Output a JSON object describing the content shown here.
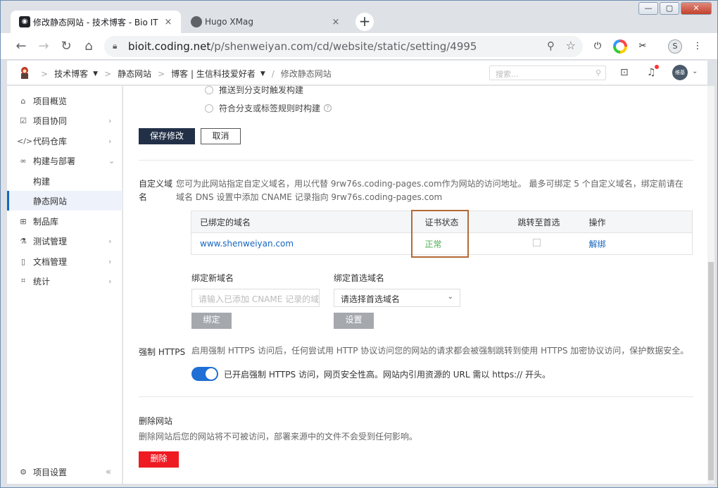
{
  "browser": {
    "tabs": [
      {
        "title": "修改静态网站 - 技术博客 - Bio IT",
        "close": "×"
      },
      {
        "title": "Hugo XMag",
        "close": "×"
      }
    ],
    "new_tab": "+",
    "window_buttons": {
      "min": "—",
      "max": "▢",
      "close": "✕"
    },
    "url_host": "bioit.coding.net",
    "url_path": "/p/shenweiyan.com/cd/website/static/setting/4995",
    "profile_initial": "S"
  },
  "header": {
    "crumbs": [
      "技术博客",
      "静态网站",
      "博客 | 生信科技爱好者",
      "修改静态网站"
    ],
    "search_placeholder": "搜索...",
    "avatar_text": "维基"
  },
  "sidebar": {
    "items": [
      {
        "label": "项目概览",
        "icon": "home-icon"
      },
      {
        "label": "项目协同",
        "icon": "checkbox-icon"
      },
      {
        "label": "代码仓库",
        "icon": "code-icon"
      },
      {
        "label": "构建与部署",
        "icon": "infinity-icon"
      },
      {
        "label": "构建"
      },
      {
        "label": "静态网站"
      },
      {
        "label": "制品库",
        "icon": "package-icon"
      },
      {
        "label": "测试管理",
        "icon": "flask-icon"
      },
      {
        "label": "文档管理",
        "icon": "document-icon"
      },
      {
        "label": "统计",
        "icon": "chart-icon"
      }
    ],
    "footer_label": "项目设置",
    "collapse_label": "«"
  },
  "main": {
    "radio_1": "推送到分支时触发构建",
    "radio_2": "符合分支或标签规则时构建",
    "save_label": "保存修改",
    "cancel_label": "取消",
    "custom_domain_label": "自定义域名",
    "custom_domain_desc": "您可为此网站指定自定义域名，用以代替 9rw76s.coding-pages.com作为网站的访问地址。 最多可绑定 5 个自定义域名，绑定前请在域名 DNS 设置中添加 CNAME 记录指向 9rw76s.coding-pages.com",
    "table": {
      "headers": [
        "已绑定的域名",
        "证书状态",
        "跳转至首选",
        "操作"
      ],
      "rows": [
        {
          "domain": "www.shenweiyan.com",
          "status": "正常",
          "action": "解绑"
        }
      ]
    },
    "bind_new_label": "绑定新域名",
    "bind_new_placeholder": "请输入已添加 CNAME 记录的域名",
    "bind_button": "绑定",
    "preferred_label": "绑定首选域名",
    "preferred_value": "请选择首选域名",
    "set_button": "设置",
    "https_label": "强制 HTTPS",
    "https_desc": "启用强制 HTTPS 访问后，任何尝试用 HTTP 协议访问您的网站的请求都会被强制跳转到使用 HTTPS 加密协议访问，保护数据安全。",
    "https_toggle_text": "已开启强制 HTTPS 访问，网页安全性高。网站内引用资源的 URL 需以 https:// 开头。",
    "https_enabled": true,
    "delete_title": "删除网站",
    "delete_desc": "删除网站后您的网站将不可被访问，部署来源中的文件不会受到任何影响。",
    "delete_button": "删除"
  },
  "colors": {
    "primary_dark": "#223047",
    "link": "#1565c0",
    "ok": "#4caf50",
    "danger": "#ef1b22",
    "toggle_on": "#1f6fd4",
    "highlight_box": "#b36a36"
  }
}
